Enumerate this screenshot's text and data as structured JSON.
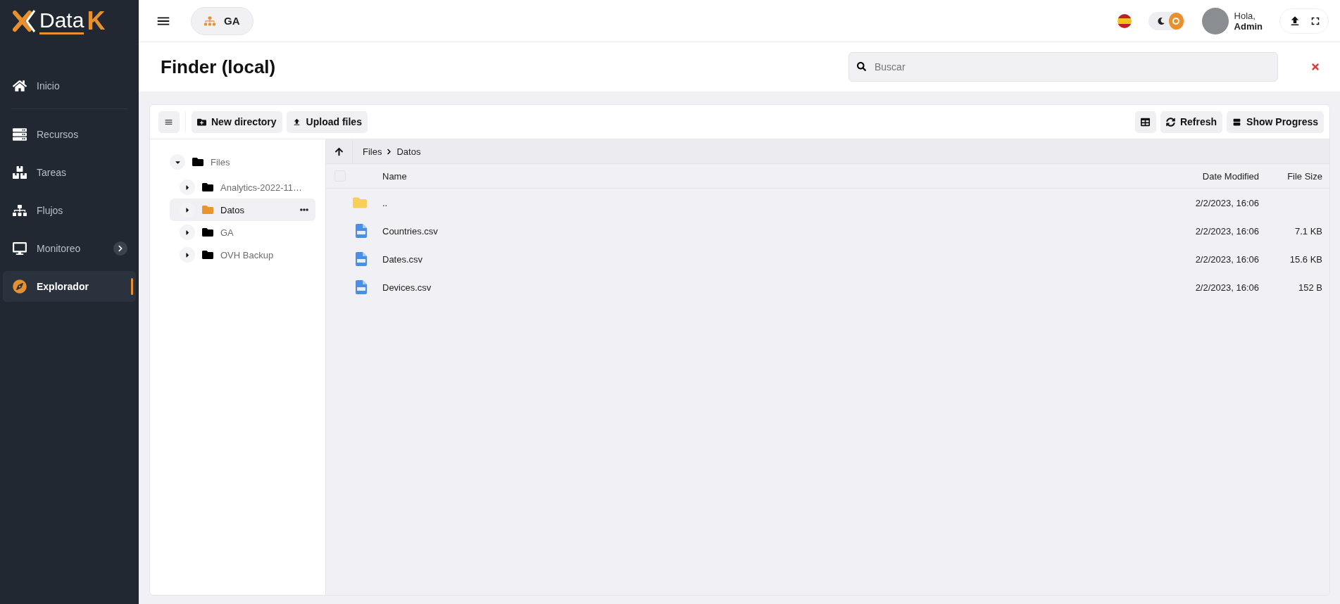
{
  "logo": {
    "word": "Data",
    "letter": "K"
  },
  "sidebar": {
    "items": [
      {
        "label": "Inicio",
        "kind": "home",
        "selected": false,
        "expandable": false
      },
      {
        "label": "Recursos",
        "kind": "servers",
        "selected": false,
        "expandable": false
      },
      {
        "label": "Tareas",
        "kind": "boxes",
        "selected": false,
        "expandable": false
      },
      {
        "label": "Flujos",
        "kind": "sitemap",
        "selected": false,
        "expandable": false
      },
      {
        "label": "Monitoreo",
        "kind": "monitor",
        "selected": false,
        "expandable": true
      },
      {
        "label": "Explorador",
        "kind": "compass",
        "selected": true,
        "expandable": false
      }
    ]
  },
  "topbar": {
    "project": "GA",
    "theme_light": true,
    "greeting": "Hola,",
    "user": "Admin"
  },
  "header": {
    "title": "Finder (local)",
    "search": {
      "placeholder": "Buscar"
    }
  },
  "toolbar": {
    "left": [
      {
        "kind": "menu"
      },
      {
        "kind": "create",
        "label": "New directory"
      },
      {
        "kind": "upload",
        "label": "Upload files"
      }
    ],
    "right": [
      {
        "kind": "view"
      },
      {
        "kind": "refresh",
        "label": "Refresh"
      },
      {
        "kind": "progress",
        "label": "Show Progress"
      }
    ]
  },
  "tree": {
    "label": "Files",
    "expanded": true,
    "selected": false,
    "children": [
      {
        "label": "Analytics-2022-11…",
        "expanded": false,
        "selected": false
      },
      {
        "label": "Datos",
        "expanded": false,
        "selected": true
      },
      {
        "label": "GA",
        "expanded": false,
        "selected": false
      },
      {
        "label": "OVH Backup",
        "expanded": false,
        "selected": false
      }
    ]
  },
  "breadcrumb": [
    "Files",
    "Datos"
  ],
  "table": {
    "all_checked": false,
    "columns": [
      "Name",
      "Date Modified",
      "File Size"
    ],
    "rows": [
      {
        "kind": "folder",
        "name": "..",
        "date": "2/2/2023, 16:06"
      },
      {
        "kind": "csv",
        "name": "Countries.csv",
        "date": "2/2/2023, 16:06",
        "size": "7.1 KB"
      },
      {
        "kind": "csv",
        "name": "Dates.csv",
        "date": "2/2/2023, 16:06",
        "size": "15.6 KB"
      },
      {
        "kind": "csv",
        "name": "Devices.csv",
        "date": "2/2/2023, 16:06",
        "size": "152 B"
      }
    ]
  }
}
